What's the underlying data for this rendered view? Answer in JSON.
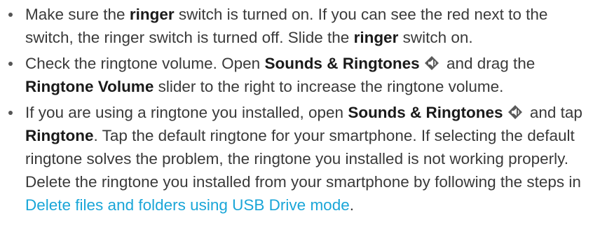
{
  "bullets": [
    {
      "segments": [
        {
          "t": "text",
          "v": "Make sure the "
        },
        {
          "t": "bold",
          "v": "ringer"
        },
        {
          "t": "text",
          "v": " switch is turned on. If you can see the red next to the switch, the ringer switch is turned off. Slide the "
        },
        {
          "t": "bold",
          "v": "ringer"
        },
        {
          "t": "text",
          "v": " switch on."
        }
      ]
    },
    {
      "segments": [
        {
          "t": "text",
          "v": "Check the ringtone volume. Open "
        },
        {
          "t": "bold",
          "v": "Sounds & Ringtones"
        },
        {
          "t": "icon",
          "v": "sounds-ringtones-icon"
        },
        {
          "t": "text",
          "v": " and drag the "
        },
        {
          "t": "bold",
          "v": "Ringtone Volume"
        },
        {
          "t": "text",
          "v": " slider to the right to increase the ringtone volume."
        }
      ]
    },
    {
      "segments": [
        {
          "t": "text",
          "v": "If you are using a ringtone you installed, open "
        },
        {
          "t": "bold",
          "v": "Sounds & Ringtones"
        },
        {
          "t": "icon",
          "v": "sounds-ringtones-icon"
        },
        {
          "t": "text",
          "v": " and tap "
        },
        {
          "t": "bold",
          "v": "Ringtone"
        },
        {
          "t": "text",
          "v": ". Tap the default ringtone for your smartphone. If selecting the default ringtone solves the problem, the ringtone you installed is not working properly. Delete the ringtone you installed from your smartphone by following the steps in "
        },
        {
          "t": "link",
          "v": "Delete files and folders using USB Drive mode"
        },
        {
          "t": "text",
          "v": "."
        }
      ]
    }
  ],
  "colors": {
    "text": "#3a3a3a",
    "bold": "#1a1a1a",
    "link": "#1aa6d8"
  }
}
